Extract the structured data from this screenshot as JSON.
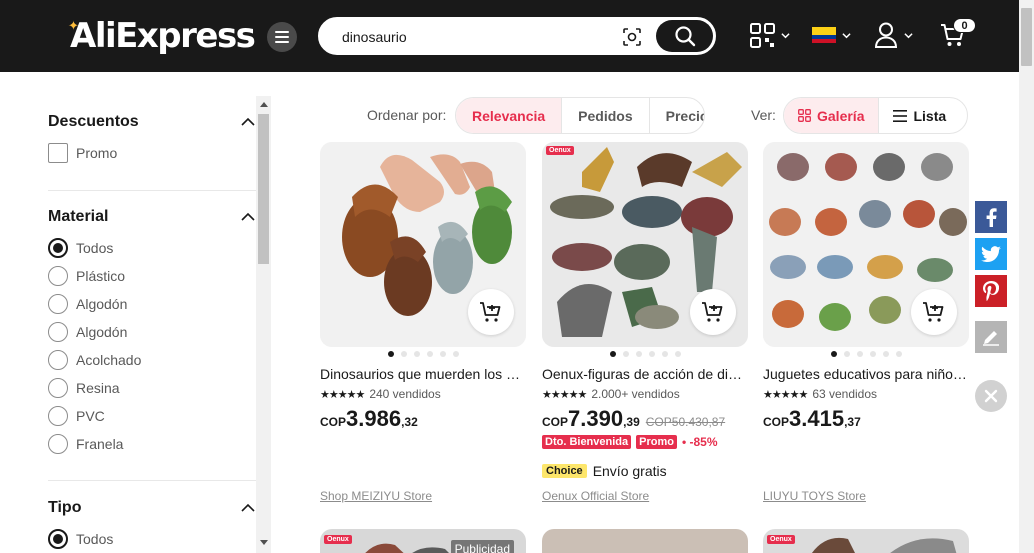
{
  "header": {
    "logo": "AliExpress",
    "search": {
      "value": "dinosaurio",
      "placeholder": ""
    },
    "cart_count": "0"
  },
  "sidebar": {
    "descuentos": {
      "title": "Descuentos",
      "options": [
        "Promo"
      ]
    },
    "material": {
      "title": "Material",
      "options": [
        "Todos",
        "Plástico",
        "Algodón",
        "Algodón",
        "Acolchado",
        "Resina",
        "PVC",
        "Franela"
      ],
      "selected": "Todos"
    },
    "tipo": {
      "title": "Tipo",
      "options": [
        "Todos"
      ],
      "selected": "Todos"
    }
  },
  "toolbar": {
    "sort_label": "Ordenar por:",
    "sort_options": [
      "Relevancia",
      "Pedidos",
      "Precio"
    ],
    "sort_active": "Relevancia",
    "view_label": "Ver:",
    "view_options": [
      "Galería",
      "Lista"
    ],
    "view_active": "Galería"
  },
  "products": [
    {
      "title": "Dinosaurios que muerden los dedos, juguetes",
      "sold": "240 vendidos",
      "price_currency": "COP",
      "price_int": "3.986",
      "price_dec": ",32",
      "store": "Shop MEIZIYU Store"
    },
    {
      "title": "Oenux-figuras de acción de dinosaurios",
      "sold": "2.000+ vendidos",
      "price_currency": "COP",
      "price_int": "7.390",
      "price_dec": ",39",
      "old_price": "COP50.430,87",
      "badge_1": "Dto. Bienvenida",
      "badge_2": "Promo",
      "discount": "-85%",
      "choice": "Choice",
      "shipping": "Envío gratis",
      "store": "Oenux Official Store",
      "brand_tag": "Oenux"
    },
    {
      "title": "Juguetes educativos para niños dinosaurio",
      "sold": "63 vendidos",
      "price_currency": "COP",
      "price_int": "3.415",
      "price_dec": ",37",
      "store": "LIUYU TOYS Store"
    }
  ],
  "row2": {
    "brand_tag_1": "Oenux",
    "ad_label": "Publicidad",
    "brand_tag_3": "Oenux"
  },
  "colors": {
    "accent": "#e62e4d",
    "header_bg": "#191919",
    "facebook": "#3b5998",
    "twitter": "#1da1f2",
    "pinterest": "#cb2027"
  }
}
